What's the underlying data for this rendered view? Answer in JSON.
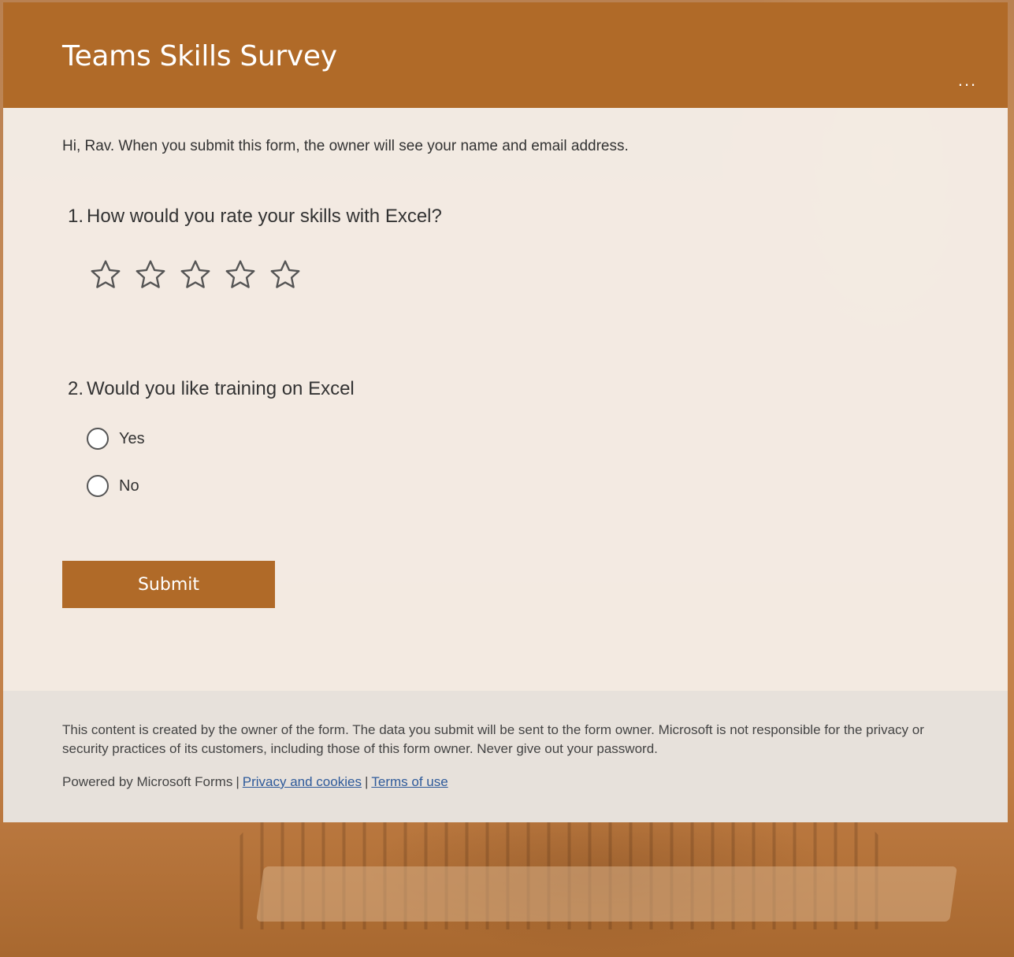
{
  "form": {
    "title": "Teams Skills Survey",
    "more_label": "...",
    "intro": "Hi, Rav. When you submit this form, the owner will see your name and email address."
  },
  "questions": [
    {
      "number": "1.",
      "text": "How would you rate your skills with Excel?",
      "type": "rating",
      "max_rating": 5,
      "current_rating": 0
    },
    {
      "number": "2.",
      "text": "Would you like training on Excel",
      "type": "choice",
      "options": [
        "Yes",
        "No"
      ],
      "selected": null
    }
  ],
  "submit_label": "Submit",
  "footer": {
    "disclaimer": "This content is created by the owner of the form. The data you submit will be sent to the form owner. Microsoft is not responsible for the privacy or security practices of its customers, including those of this form owner. Never give out your password.",
    "powered_by": "Powered by Microsoft Forms",
    "separator": "|",
    "privacy_link": "Privacy and cookies",
    "terms_link": "Terms of use"
  },
  "colors": {
    "accent": "#b06a28",
    "link": "#2e5a9a"
  },
  "icons": {
    "rating": "star-outline-icon",
    "more": "more-options-icon"
  }
}
